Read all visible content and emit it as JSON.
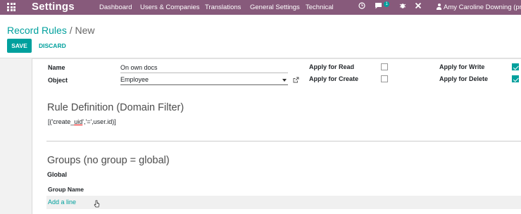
{
  "navbar": {
    "app_title": "Settings",
    "menu": [
      "Dashboard",
      "Users & Companies",
      "Translations",
      "General Settings",
      "Technical"
    ],
    "messages_count": "1",
    "user_name": "Amy Caroline Downing (priv"
  },
  "breadcrumb": {
    "parent": "Record Rules",
    "separator": "/",
    "current": "New"
  },
  "buttons": {
    "save": "SAVE",
    "discard": "DISCARD"
  },
  "form": {
    "name_label": "Name",
    "name_value": "On own docs",
    "object_label": "Object",
    "object_value": "Employee",
    "apply_read_label": "Apply for Read",
    "apply_read": false,
    "apply_create_label": "Apply for Create",
    "apply_create": false,
    "apply_write_label": "Apply for Write",
    "apply_write": true,
    "apply_delete_label": "Apply for Delete",
    "apply_delete": true
  },
  "rule_definition": {
    "title": "Rule Definition (Domain Filter)",
    "domain_prefix": "[('create_",
    "domain_underlined": "uid",
    "domain_suffix": "','=',user.id)]"
  },
  "groups": {
    "title": "Groups (no group = global)",
    "global_label": "Global",
    "column_header": "Group Name",
    "add_line": "Add a line"
  },
  "colors": {
    "navbar": "#875A7B",
    "accent": "#00A09D"
  }
}
